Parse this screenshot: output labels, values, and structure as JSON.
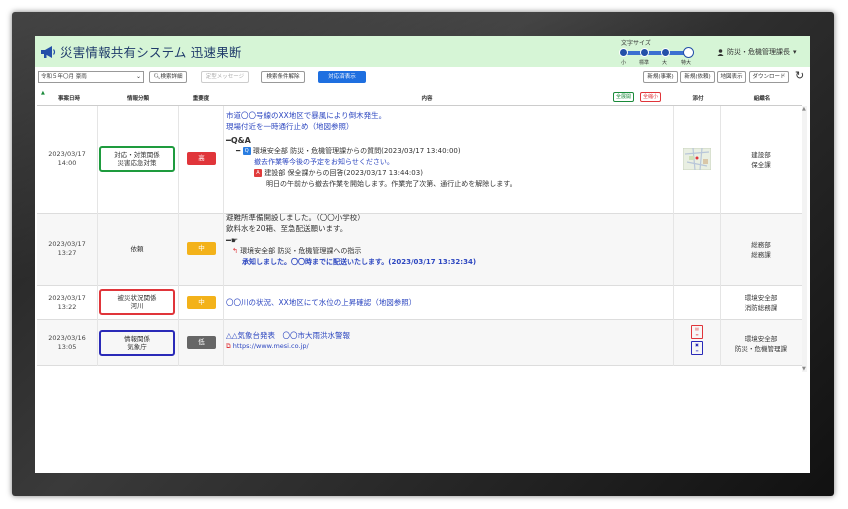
{
  "header": {
    "title": "災害情報共有システム 迅速果断",
    "font_size_label": "文字サイズ",
    "font_size_options": [
      "小",
      "標準",
      "大",
      "特大"
    ],
    "font_size_selected": "大",
    "user_name": "防災・危機管理課長",
    "user_caret": "▾"
  },
  "toolbar": {
    "period_select": "令和５年〇月 豪雨",
    "search_detail": "検索詳細",
    "template_messages": "定型メッセージ",
    "clear_conditions": "検索条件解除",
    "show_in_progress": "対応済表示",
    "new_incident": "新規(事案)",
    "new_contact": "新規(依頼)",
    "map_view": "地図表示",
    "download": "ダウンロード",
    "refresh_icon": "↻"
  },
  "table": {
    "columns": {
      "date": "事案日時",
      "category": "情報分類",
      "importance": "重要度",
      "content": "内容",
      "attachment": "添付",
      "department": "組織名"
    },
    "expand_all": "全展開",
    "collapse_all": "全縮小",
    "sort_mark": "▲",
    "rows": [
      {
        "date": "2023/03/17",
        "time": "14:00",
        "category_line1": "対応・対策関係",
        "category_line2": "災害応急対策",
        "category_color": "#1e9b3e",
        "importance": "高",
        "importance_color": "#e0353a",
        "line1": "市道〇〇号線のXX地区で暴風により倒木発生。",
        "line2": "現場付近を一時通行止め（地図参照）",
        "qa_label": "Q&A",
        "q_label": "Q",
        "q_text": "環境安全部 防災・危機管理課からの質問(2023/03/17 13:40:00)",
        "q_body": "撤去作業等今後の予定をお知らせください。",
        "a_label": "A",
        "a_text": "建設部 保全課からの回答(2023/03/17 13:44:03)",
        "a_body": "明日の午前から撤去作業を開始します。作業完了次第、通行止めを解除します。",
        "dept_line1": "建設部",
        "dept_line2": "保全課"
      },
      {
        "date": "2023/03/17",
        "time": "13:27",
        "category_line1": "依頼",
        "importance": "中",
        "importance_color": "#f3b21a",
        "line1": "避難所準備開設しました。（〇〇小学校）",
        "line2": "飲料水を20箱、至急配送願います。",
        "instr_text": "環境安全部 防災・危機管理課への指示",
        "instr_body": "承知しました。〇〇時までに配送いたします。(2023/03/17 13:32:34)",
        "dept_line1": "総務部",
        "dept_line2": "総務課"
      },
      {
        "date": "2023/03/17",
        "time": "13:22",
        "category_line1": "被災状況関係",
        "category_line2": "河川",
        "category_color": "#e0353a",
        "importance": "中",
        "importance_color": "#f3b21a",
        "line1": "〇〇川の状況、XX地区にて水位の上昇確認（地図参照）",
        "dept_line1": "環境安全部",
        "dept_line2": "消防総務課"
      },
      {
        "date": "2023/03/16",
        "time": "13:05",
        "category_line1": "情報関係",
        "category_line2": "気象庁",
        "category_color": "#2a2ab8",
        "importance": "低",
        "importance_color": "#666666",
        "line1": "△△気象台発表　〇〇市大雨洪水警報",
        "line2": "https://www.mesi.co.jp/",
        "dept_line1": "環境安全部",
        "dept_line2": "防災・危機管理課"
      }
    ]
  }
}
